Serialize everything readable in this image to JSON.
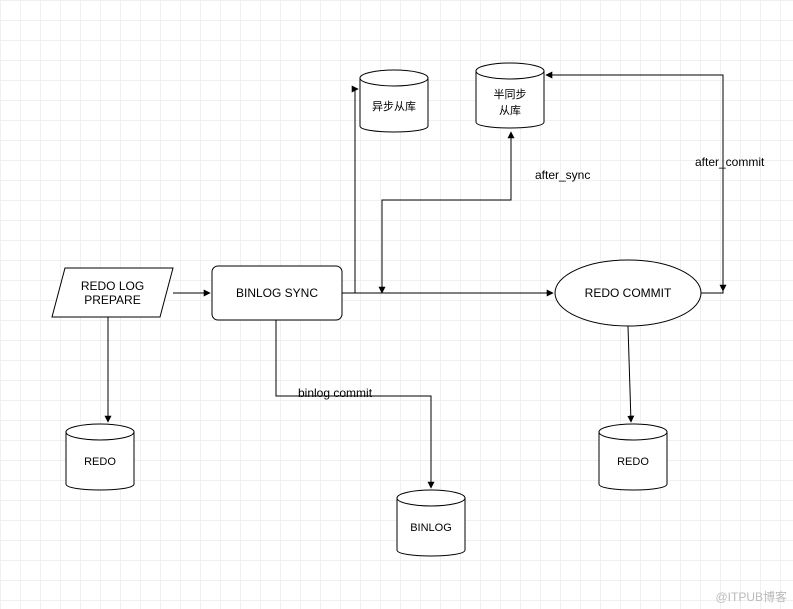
{
  "nodes": {
    "redo_log_prepare": "REDO LOG\nPREPARE",
    "binlog_sync": "BINLOG SYNC",
    "redo_commit": "REDO COMMIT",
    "cyl_async_slave": "异步从库",
    "cyl_semisync_slave": "半同步\n从库",
    "cyl_redo_left": "REDO",
    "cyl_redo_right": "REDO",
    "cyl_binlog": "BINLOG"
  },
  "edges": {
    "binlog_commit": "binlog commit",
    "after_sync": "after_sync",
    "after_commit": "after_commit"
  },
  "watermark": "@ITPUB博客"
}
